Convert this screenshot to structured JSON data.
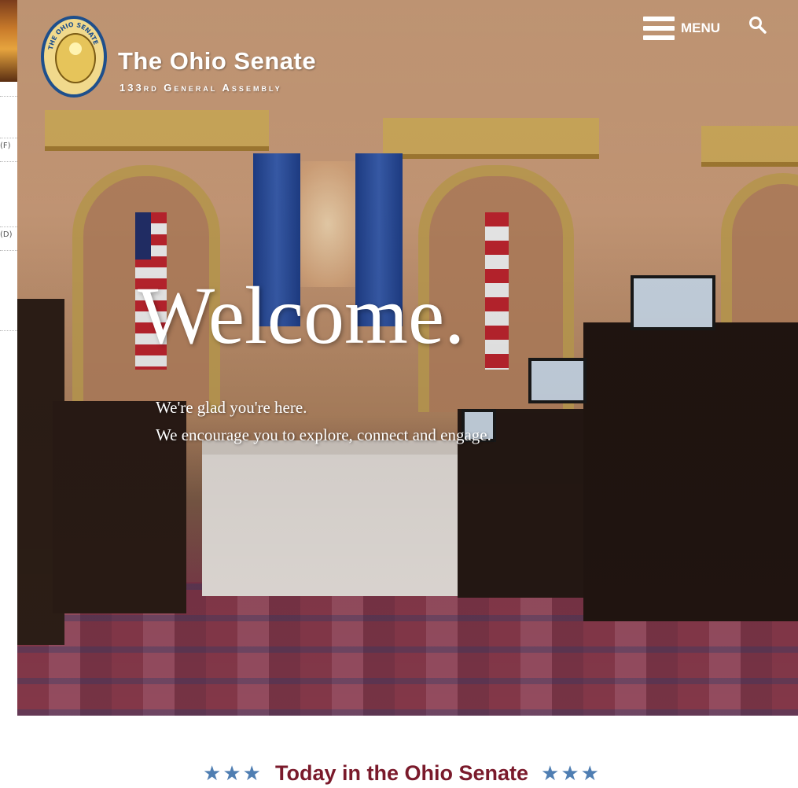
{
  "header": {
    "seal_text": "THE OHIO SENATE",
    "title": "The Ohio Senate",
    "subtitle": "133rd General Assembly"
  },
  "nav": {
    "menu_label": "MENU"
  },
  "hero": {
    "heading": "Welcome.",
    "line1": "We're glad you're here.",
    "line2": "We encourage you to explore, connect and engage."
  },
  "today": {
    "stars_left": "★★★",
    "title": "Today in the Ohio Senate",
    "stars_right": "★★★"
  },
  "background_window": {
    "fragment_1": "(F)",
    "fragment_2": "(D)"
  },
  "colors": {
    "brand_maroon": "#7a1a2b",
    "star_blue": "#4f7eb2",
    "seal_blue": "#1e4f8c"
  }
}
